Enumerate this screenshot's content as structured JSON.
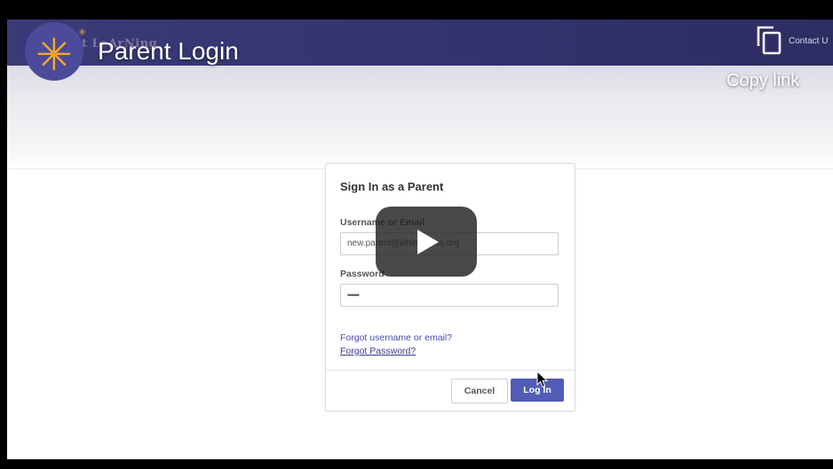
{
  "site": {
    "brand_text": "t LeArNing",
    "contact_label": "Contact U"
  },
  "video": {
    "title": "Parent Login",
    "copy_link_label": "Copy link",
    "channel_icon": "asterisk-logo-icon",
    "play_icon": "play-icon",
    "copy_icon": "copy-icon"
  },
  "login": {
    "title": "Sign In as a Parent",
    "username_label": "Username or Email",
    "username_value": "new.parent@whitneyphs.org",
    "password_label": "Password",
    "password_value": "••••••",
    "forgot_username": "Forgot username or email?",
    "forgot_password": "Forgot Password?",
    "cancel_label": "Cancel",
    "login_label": "Log In"
  },
  "colors": {
    "header_bg": "#33336e",
    "accent": "#4f5db5",
    "logo_orange": "#f7a531"
  }
}
